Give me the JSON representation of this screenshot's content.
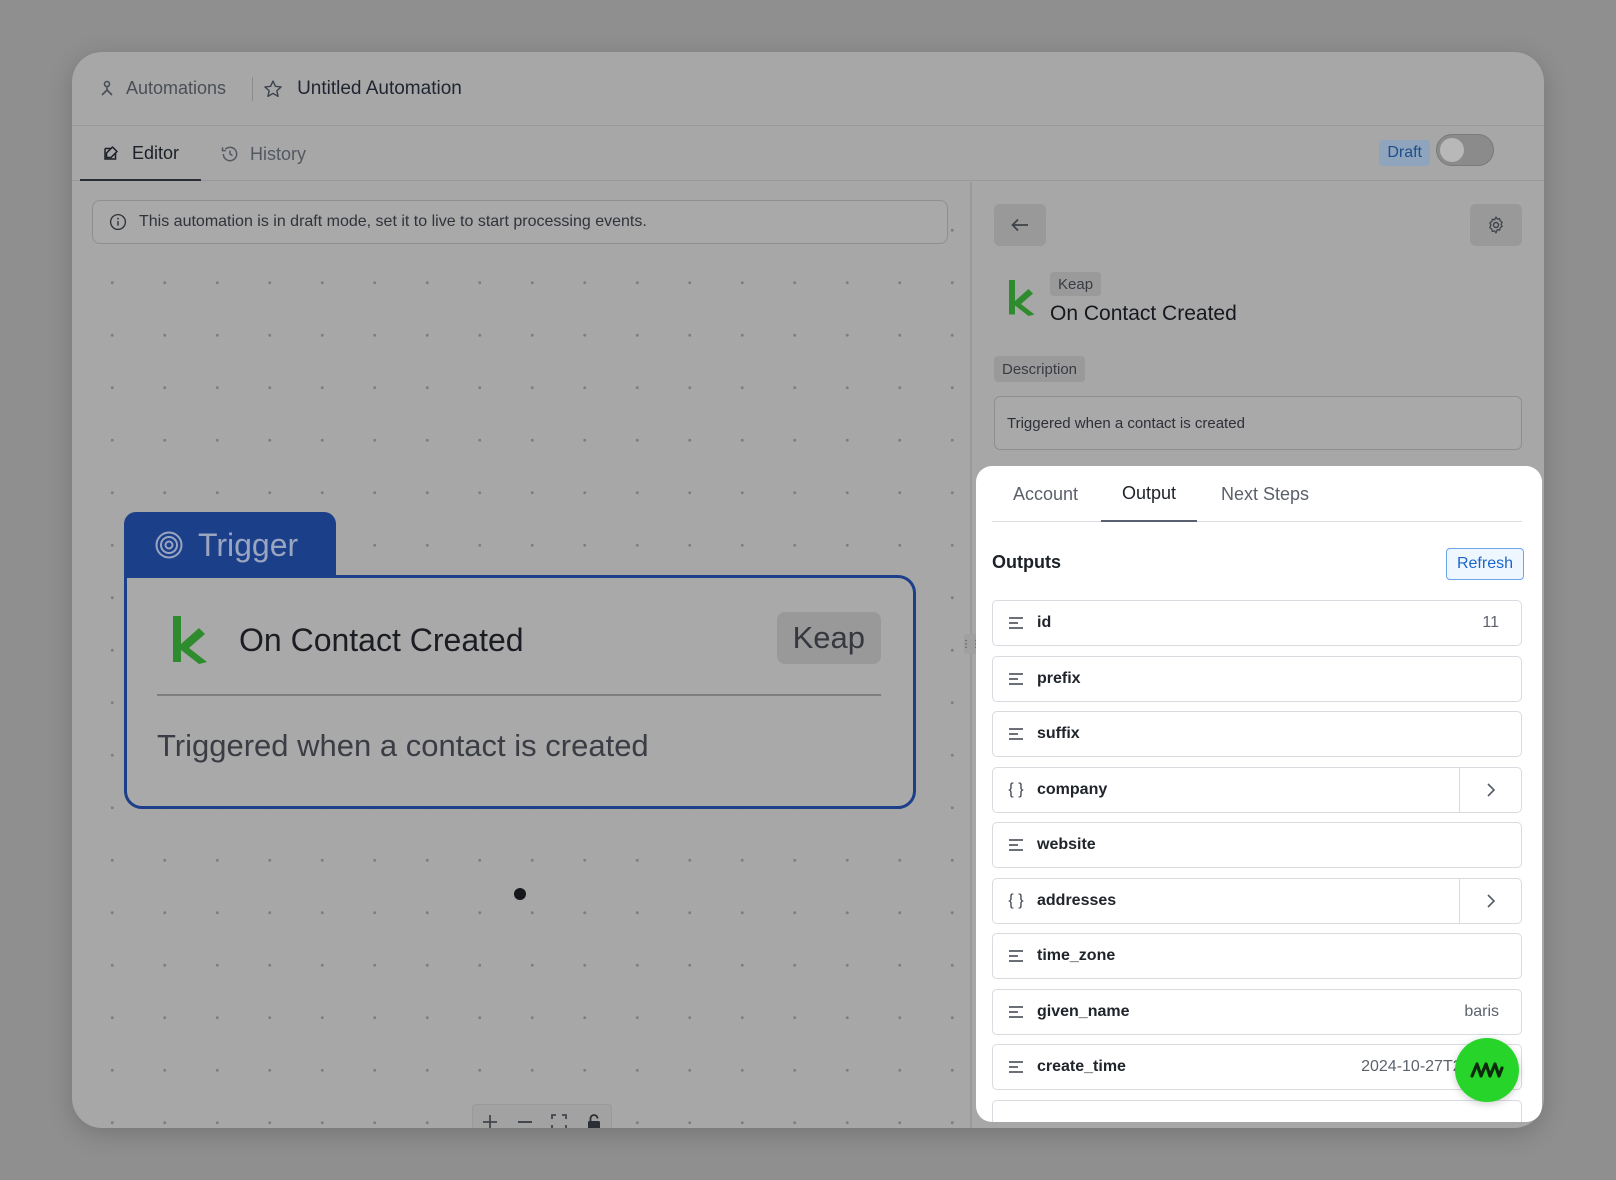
{
  "breadcrumb": {
    "parent": "Automations",
    "title": "Untitled Automation"
  },
  "tabs": [
    {
      "label": "Editor",
      "icon": "edit-icon",
      "active": true
    },
    {
      "label": "History",
      "icon": "history-icon",
      "active": false
    }
  ],
  "status": {
    "badge": "Draft",
    "live": false
  },
  "banner": {
    "text": "This automation is in draft mode, set it to live to start processing events."
  },
  "trigger_node": {
    "header": "Trigger",
    "title": "On Contact Created",
    "app": "Keap",
    "description": "Triggered when a contact is created"
  },
  "sidebar": {
    "app": "Keap",
    "title": "On Contact Created",
    "description_label": "Description",
    "description": "Triggered when a contact is created"
  },
  "panel": {
    "tabs": [
      {
        "label": "Account",
        "active": false
      },
      {
        "label": "Output",
        "active": true
      },
      {
        "label": "Next Steps",
        "active": false
      }
    ],
    "outputs_title": "Outputs",
    "refresh_label": "Refresh",
    "rows": [
      {
        "name": "id",
        "type": "text",
        "value": "11"
      },
      {
        "name": "prefix",
        "type": "text",
        "value": ""
      },
      {
        "name": "suffix",
        "type": "text",
        "value": ""
      },
      {
        "name": "company",
        "type": "object",
        "value": ""
      },
      {
        "name": "website",
        "type": "text",
        "value": ""
      },
      {
        "name": "addresses",
        "type": "object",
        "value": ""
      },
      {
        "name": "time_zone",
        "type": "text",
        "value": ""
      },
      {
        "name": "given_name",
        "type": "text",
        "value": "baris"
      },
      {
        "name": "create_time",
        "type": "text",
        "value": "2024-10-27T20:48:04"
      }
    ]
  },
  "colors": {
    "trigger": "#1c3f8a",
    "keap_green": "#2e8b2e",
    "fab": "#27d52a",
    "refresh": "#1b66c9"
  }
}
